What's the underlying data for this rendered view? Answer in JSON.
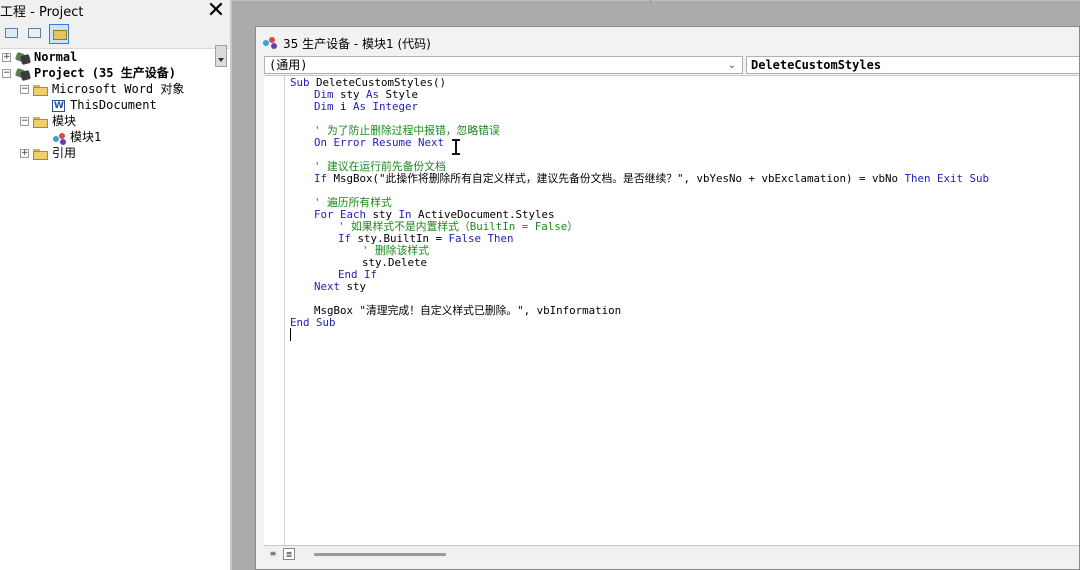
{
  "project_pane": {
    "title": "工程 - Project",
    "close_glyph": "✕",
    "tree": {
      "normal": "Normal",
      "project": "Project (35 生产设备)",
      "word_objects": "Microsoft Word 对象",
      "this_document": "ThisDocument",
      "modules": "模块",
      "module1": "模块1",
      "references": "引用"
    },
    "expanders": {
      "plus": "+",
      "minus": "−"
    }
  },
  "code_window": {
    "title": "35 生产设备 - 模块1 (代码)",
    "object_combo": "(通用)",
    "object_combo_arrow": "⌄",
    "procedure_combo": "DeleteCustomStyles",
    "lines": {
      "l1_kw": "Sub",
      "l1_rest": " DeleteCustomStyles()",
      "l2_kw1": "Dim",
      "l2_mid": " sty ",
      "l2_kw2": "As",
      "l2_rest": " Style",
      "l3_kw1": "Dim",
      "l3_mid": " i ",
      "l3_kw2": "As Integer",
      "l5_comment": "' 为了防止删除过程中报错，忽略错误",
      "l6_kw": "On Error Resume Next",
      "l8_comment": "' 建议在运行前先备份文档",
      "l9_kw1": "If",
      "l9_mid": " MsgBox(\"此操作将删除所有自定义样式，建议先备份文档。是否继续？\", vbYesNo + vbExclamation) = vbNo ",
      "l9_kw2": "Then Exit Sub",
      "l11_comment": "' 遍历所有样式",
      "l12_kw1": "For Each",
      "l12_mid": " sty ",
      "l12_kw2": "In",
      "l12_rest": " ActiveDocument.Styles",
      "l13_comment": "' 如果样式不是内置样式（BuiltIn = False）",
      "l14_kw1": "If",
      "l14_mid": " sty.BuiltIn = ",
      "l14_kw2": "False Then",
      "l15_comment": "' 删除该样式",
      "l16_text": "sty.Delete",
      "l17_kw": "End If",
      "l18_kw": "Next",
      "l18_rest": " sty",
      "l20_text": "MsgBox \"清理完成！自定义样式已删除。\", vbInformation",
      "l21_kw": "End Sub"
    },
    "bottom": {
      "proc_view_glyph": "≡",
      "full_view_glyph": "≣"
    }
  },
  "colors": {
    "keyword": "#1f1fb4",
    "comment": "#1a8a1a",
    "text": "#000000"
  },
  "icons": [
    "project-icon",
    "folder-icon",
    "document-icon",
    "module-icon",
    "view-code-icon",
    "view-object-icon",
    "toggle-folders-icon",
    "close-icon"
  ]
}
